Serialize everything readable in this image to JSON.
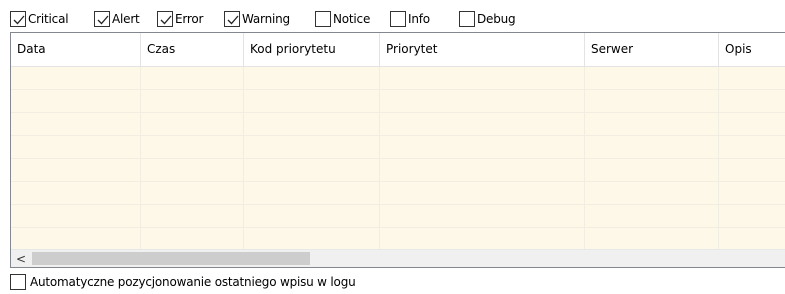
{
  "filters": [
    {
      "label": "Critical",
      "checked": true
    },
    {
      "label": "Alert",
      "checked": true
    },
    {
      "label": "Error",
      "checked": true
    },
    {
      "label": "Warning",
      "checked": true
    },
    {
      "label": "Notice",
      "checked": false
    },
    {
      "label": "Info",
      "checked": false
    },
    {
      "label": "Debug",
      "checked": false
    }
  ],
  "table": {
    "columns": [
      "Data",
      "Czas",
      "Kod priorytetu",
      "Priorytet",
      "Serwer",
      "Opis"
    ],
    "rows": []
  },
  "scrollbar": {
    "left_arrow": "<"
  },
  "auto_scroll": {
    "label": "Automatyczne pozycjonowanie ostatniego wpisu w logu",
    "checked": false
  },
  "colors": {
    "row_background": "#fdf8e7",
    "grid_border": "#828790",
    "scrollbar_thumb": "#cdcdcd"
  }
}
